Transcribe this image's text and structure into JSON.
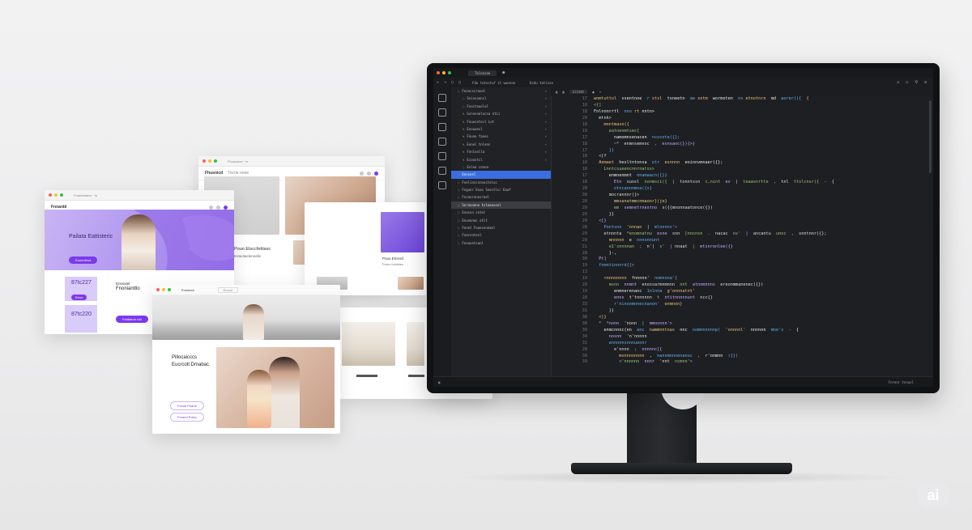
{
  "window_a": {
    "url": "Fnawshtalvn  ·  ln",
    "brand": "Fnnanbl",
    "hero_title": "Pailata Eattisteric",
    "hero_button": "Enucrdend",
    "card1_value": "87tc227",
    "card1_button": "Eeno",
    "card2_value": "87tc220",
    "col_head": "Enssutel",
    "col_text": "Fnonianttlo",
    "cta": "Fnntaeun rdn"
  },
  "window_b": {
    "url": "Fhuaosion  ·  ln",
    "brand": "Fhusnicd",
    "nav_text": "Tocrie ronie",
    "caption": "Pouo Etsccfettiasc",
    "caption2": "Eotuotaclonnalis"
  },
  "window_c": {
    "card_title": "Pouo Elcnncl",
    "card_text": "Freno loivietes"
  },
  "window_d": {
    "brand": "Fnnmonl",
    "nav_text": "Enocd",
    "title_l1": "Pillocaicccs",
    "title_l2": "Eucrcott Dmabac",
    "btn1": "Fnnutl Puane",
    "btn2": "Fnnerd Polnc",
    "ref1": "Fnccvrdicl",
    "ref2": "Fnentnerl"
  },
  "ide": {
    "tab": "Tolossoe",
    "nav_path": "Fdu tatestuf it waonoe",
    "nav_path2": "Dsdu tatiose",
    "open_file": "Gitddt",
    "explorer": [
      {
        "label": "Fnnocssreonl",
        "chev": "▾"
      },
      {
        "label": "Sniosoonsl",
        "chev": "▾"
      },
      {
        "label": "Fnoctoeolel",
        "chev": "▾"
      },
      {
        "label": "Gcnnsnelocsa ntii",
        "chev": "▾"
      },
      {
        "label": "Fouecetocl Lnt",
        "chev": "▾"
      },
      {
        "label": "Enouoesl",
        "chev": "▾"
      },
      {
        "label": "Fnuno fanes",
        "chev": "▾"
      },
      {
        "label": "Eonel tnlens",
        "chev": "▾"
      },
      {
        "label": "Fnnloolla",
        "chev": "▾"
      },
      {
        "label": "Ecoostcl",
        "chev": "▾"
      },
      {
        "label": "Enlea conna",
        "chev": ""
      },
      {
        "label": "Enncesl",
        "chev": ""
      },
      {
        "label": "Fnelinccsnnocteloc",
        "chev": ""
      },
      {
        "label": "Fngunr Enac Snectlcr Eaaf",
        "chev": ""
      },
      {
        "label": "Fnsnoronesrael",
        "chev": ""
      },
      {
        "label": "Snrnonene tnloeasonl",
        "chev": ""
      },
      {
        "label": "Enacon sotel",
        "chev": ""
      },
      {
        "label": "Enunanas otlt",
        "chev": ""
      },
      {
        "label": "Fnnet Foaeceneael",
        "chev": ""
      },
      {
        "label": "Foarnnteol",
        "chev": ""
      },
      {
        "label": "Fnnoootsanl",
        "chev": ""
      }
    ],
    "line_numbers": [
      "17",
      "18",
      "18",
      "29",
      "18",
      "19",
      "17",
      "18",
      "17",
      "18",
      "18",
      "18",
      "17",
      "18",
      "28",
      "38",
      "28",
      "29",
      "29",
      "29",
      "28",
      "29",
      "29",
      "21",
      "28",
      "30",
      "19",
      "13",
      "19",
      "20",
      "19",
      "28",
      "33",
      "31",
      "38",
      "38",
      "39",
      "34",
      "31",
      "28",
      "38",
      "39"
    ],
    "code_lines": [
      "wnmtuttol  ssentnoe  r stsl  tsneetn  ae sotm  wormoten  ns etnotnrn  md  aorer(){  {",
      "<{]",
      "Fnlnnnrrtl  nno rt nntn>",
      "  mtnk>",
      "    mnntmasn({",
      "      eatnenmtsec{",
      "        namomnsenacen  ncocote({};",
      "        ~*  enmnsemnoc  ,  esnsaoc(}){>}",
      "      }}",
      "  <[f",
      "  Anmaet  hesltntonsa  otr  esnnnn  eoinnvmnaer({};",
      "    Lnntcsueencnnrnatss>",
      "      enmnenmnt  nnamaacn({}}",
      "        Etn  suosl  nonmsci({  |  tonntssn  c,nint  ev  |  teaasnrtte  ,  tnl  ttslcnsr({  -  {",
      "        otncannnmoa({s}",
      "      mocrannnr(}>",
      "        mmsanatmmcnmaonr}(je}",
      "        em  semnetrnestno  s({{mnonnaatonce({})",
      "      }}",
      "  <[}",
      "    Pontsno  'nnnan  |  mlnnnns'>",
      "    etnnnta  *enomnatnu  esne  snn  [nncnsn  .  nacac  ns'  |  ancantu  unoc  ,  snntnnr({};",
      "      mnnnon  e  nnnonnunt",
      "      e1'snnnnan  ;  n'|  s'  | nnaat  |  mtsnronlee({}",
      "      }-,",
      "  Pt]",
      "  fnmntinnnrd{{>",
      "",
      "    <nnnonnnn  fnnnnn'  nnmnnna'{",
      "      msnn  nnmnt  enossarmnmnnn  nnt  atnnmnnns  ereonmmanenec({})",
      "        enmnerenanc  1nlnna  g'onnnatnt'",
      "        enns  t'tnnnnnn  t  ntitnnnnnunt  ncc{}",
      "        r'ninoomnnecnanon'  enmnon}",
      "      }}",
      "  <|}",
      "  *  *nonn  'nonn  |  mmoonnn'>",
      "    enmcnnnc(nn  anc  nammnntnas  nnc  nommnnnnnp(  'onnnnl'  nnnnnn  mne's  -  {",
      "      nosnn  'n'nnnnn",
      "      ennnnnsnnnuennr",
      "        e'nnnn  ;  nnnnnc[{",
      "          monnnonnnn  ,  nannmnnnenanuc  ,  r'onmnn  ({})",
      "          <'nnnnnn  nnnr  'nnt  ncmnn'>"
    ],
    "status_text": "Fnrenr  tnnunl"
  },
  "colors": {
    "accent": "#7c3aed",
    "ide_bg": "#1e1f22",
    "selection": "#3a6ee0"
  },
  "badge": "ai"
}
